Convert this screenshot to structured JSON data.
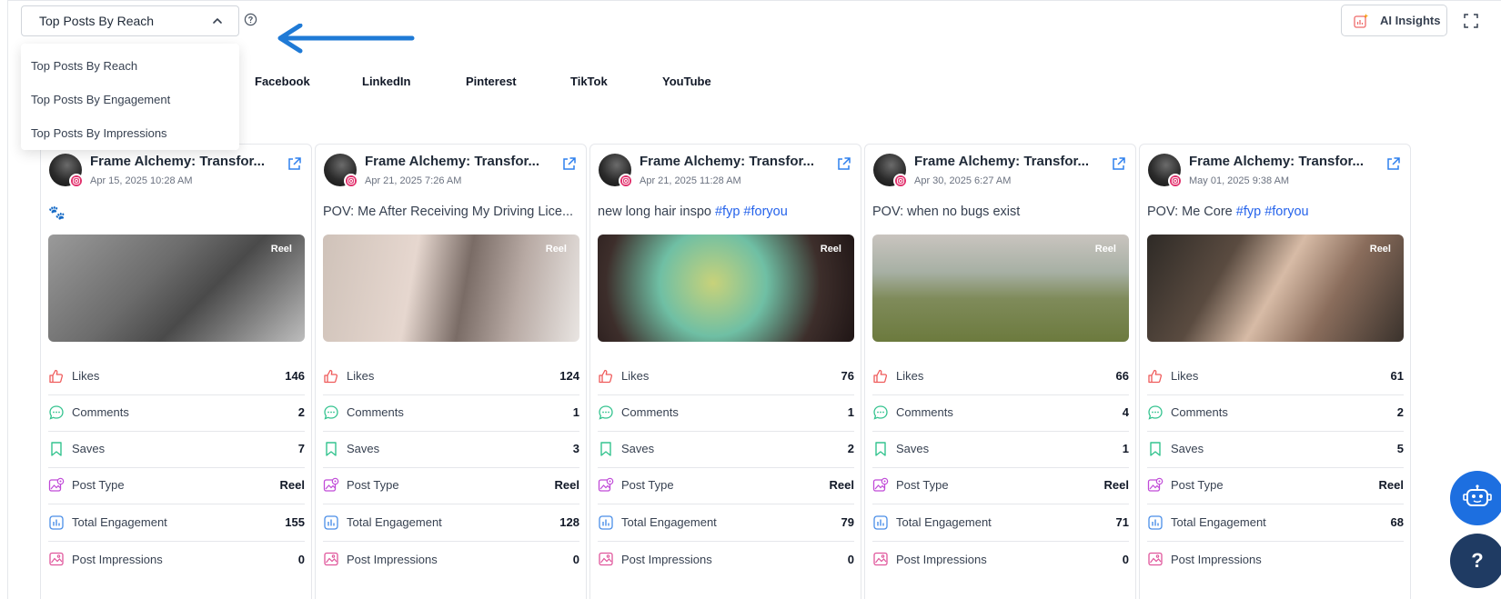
{
  "dropdown": {
    "selected": "Top Posts By Reach",
    "options": [
      "Top Posts By Reach",
      "Top Posts By Engagement",
      "Top Posts By Impressions"
    ]
  },
  "tabs": [
    "Facebook",
    "LinkedIn",
    "Pinterest",
    "TikTok",
    "YouTube"
  ],
  "ai_insights_label": "AI Insights",
  "metric_labels": {
    "likes": "Likes",
    "comments": "Comments",
    "saves": "Saves",
    "post_type": "Post Type",
    "total_engagement": "Total Engagement",
    "post_impressions": "Post Impressions"
  },
  "cards": [
    {
      "name": "Frame Alchemy: Transfor...",
      "date": "Apr 15, 2025 10:28 AM",
      "caption": "",
      "hashtags": "",
      "reel_label": "Reel",
      "likes": "146",
      "comments": "2",
      "saves": "7",
      "post_type": "Reel",
      "total_engagement": "155",
      "post_impressions": "0"
    },
    {
      "name": "Frame Alchemy: Transfor...",
      "date": "Apr 21, 2025 7:26 AM",
      "caption": "POV: Me After Receiving My Driving Lice...",
      "hashtags": "",
      "reel_label": "Reel",
      "likes": "124",
      "comments": "1",
      "saves": "3",
      "post_type": "Reel",
      "total_engagement": "128",
      "post_impressions": "0"
    },
    {
      "name": "Frame Alchemy: Transfor...",
      "date": "Apr 21, 2025 11:28 AM",
      "caption": "new long hair inspo ",
      "hashtags": "#fyp #foryou",
      "reel_label": "Reel",
      "likes": "76",
      "comments": "1",
      "saves": "2",
      "post_type": "Reel",
      "total_engagement": "79",
      "post_impressions": "0"
    },
    {
      "name": "Frame Alchemy: Transfor...",
      "date": "Apr 30, 2025 6:27 AM",
      "caption": "POV: when no bugs exist",
      "hashtags": "",
      "reel_label": "Reel",
      "likes": "66",
      "comments": "4",
      "saves": "1",
      "post_type": "Reel",
      "total_engagement": "71",
      "post_impressions": "0"
    },
    {
      "name": "Frame Alchemy: Transfor...",
      "date": "May 01, 2025 9:38 AM",
      "caption": "POV: Me Core ",
      "hashtags": "#fyp #foryou",
      "reel_label": "Reel",
      "likes": "61",
      "comments": "2",
      "saves": "5",
      "post_type": "Reel",
      "total_engagement": "68",
      "post_impressions": ""
    }
  ],
  "help_button_label": "?"
}
